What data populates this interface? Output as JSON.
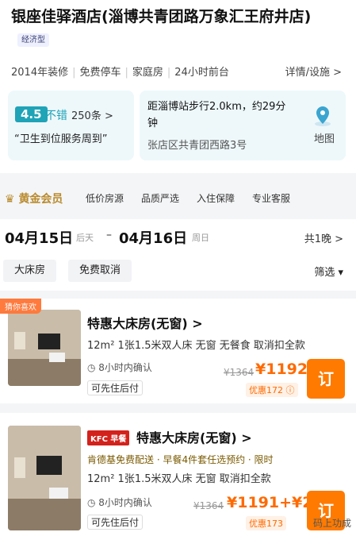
{
  "hotel": {
    "name": "银座佳驿酒店(淄博共青团路万象汇王府井店)",
    "type_badge": "经济型",
    "facilities": [
      "2014年装修",
      "免费停车",
      "家庭房",
      "24小时前台"
    ],
    "detail_link": "详情/设施 >",
    "rating": {
      "score": "4.5",
      "grade": "不错",
      "reviews": "250条 >",
      "quote": "“卫生到位服务周到”"
    },
    "location": {
      "distance": "距淄博站步行2.0km，约29分钟",
      "address": "张店区共青团西路3号",
      "map_label": "地图"
    }
  },
  "member": {
    "label": "黄金会员",
    "perks": [
      "低价房源",
      "品质严选",
      "入住保障",
      "专业客服"
    ]
  },
  "dates": {
    "checkin": "04月15日",
    "checkin_day": "后天",
    "dash": "–",
    "checkout": "04月16日",
    "checkout_day": "周日",
    "nights": "共1晚 >"
  },
  "filters": {
    "chips": [
      "大床房",
      "免费取消"
    ],
    "filter_label": "筛选 ▾"
  },
  "rooms": [
    {
      "tag": "猜你喜欢",
      "name": "特惠大床房(无窗) >",
      "specs": "12m²   1张1.5米双人床   无窗   无餐食   取消扣全款",
      "confirm": "◷ 8小时内确认",
      "pay": "可先住后付",
      "orig_price": "¥1364",
      "price": "¥1192",
      "promo": "优惠172 ⓘ",
      "book": "订",
      "photo_count": "1"
    },
    {
      "kfc_badge": "KFC 早餐",
      "name": "特惠大床房(无窗) >",
      "kfc_note": "肯德基免费配送 · 早餐4件套任选预约 · 限时",
      "specs": "12m²   1张1.5米双人床   无窗   取消扣全款",
      "confirm": "◷ 8小时内确认",
      "pay": "可先住后付",
      "orig_price": "¥1364",
      "price": "¥1191+¥26",
      "promo": "优惠173",
      "book": "订",
      "photo_count": "1"
    }
  ],
  "watermark": "码上功成",
  "colors": {
    "accent": "#ff7a00",
    "teal": "#1fa3b7",
    "gold": "#b98a2c"
  }
}
